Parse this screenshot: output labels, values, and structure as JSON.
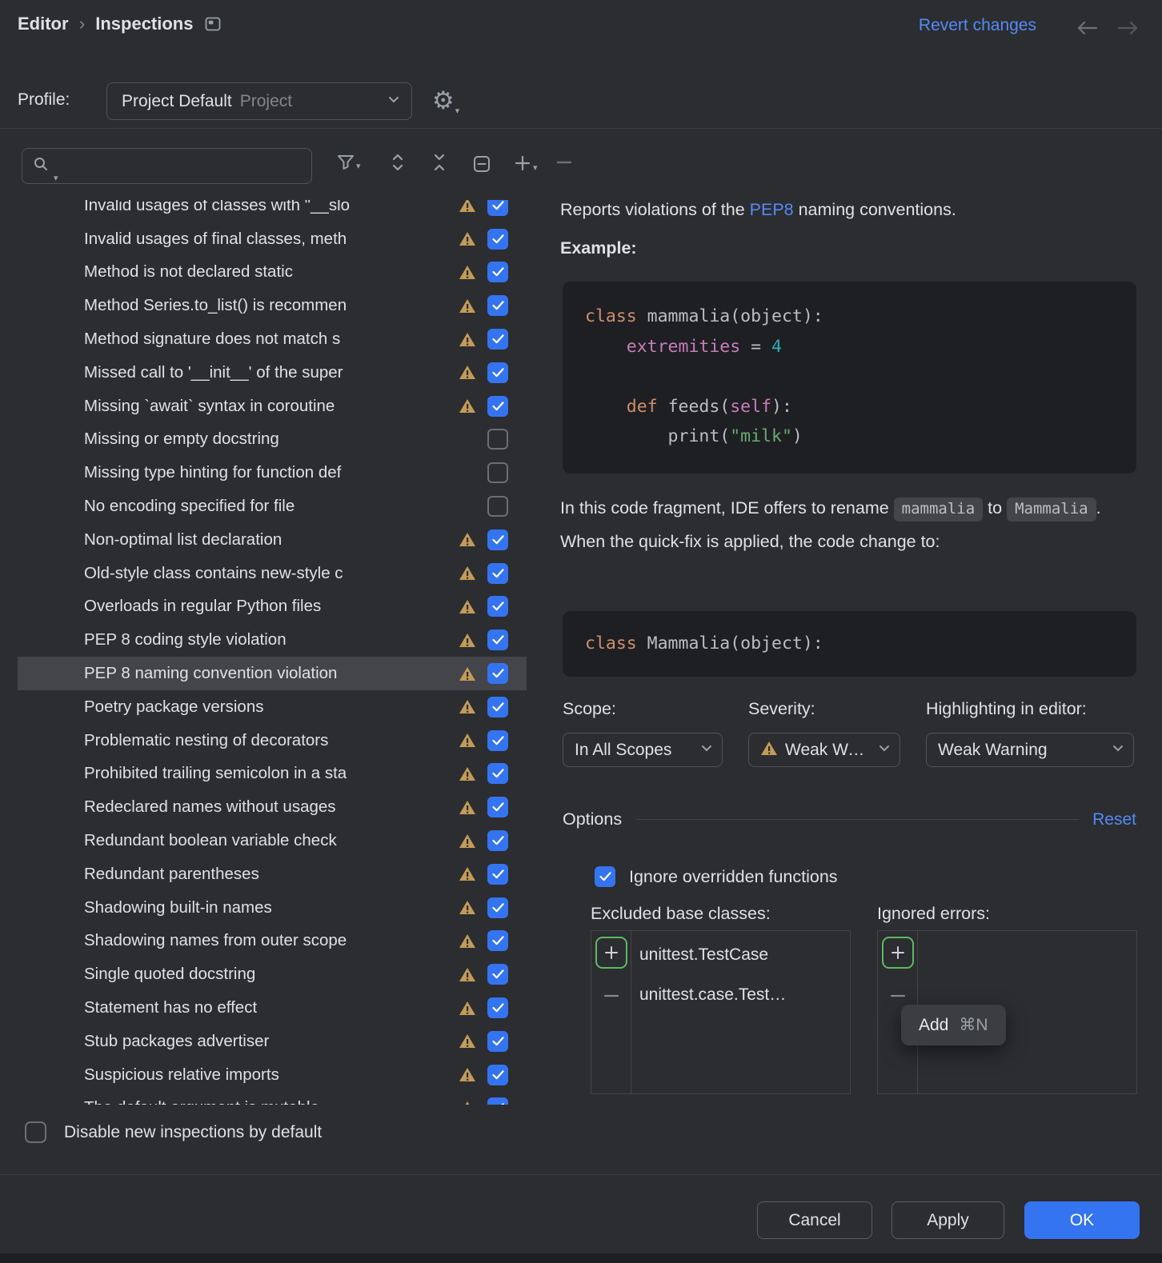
{
  "colors": {
    "accent_blue": "#3574F0",
    "link_blue": "#548AF7",
    "warning_icon": "#C39B58",
    "focus_green": "#5FB865",
    "background": "#2B2D30",
    "code_background": "#1E1F22",
    "selection_gray": "#43454A"
  },
  "header": {
    "breadcrumb": {
      "section": "Editor",
      "separator": "›",
      "page": "Inspections"
    },
    "revert_label": "Revert changes"
  },
  "profile": {
    "label": "Profile:",
    "value": "Project Default",
    "scope_hint": "Project"
  },
  "inspections": {
    "items": [
      {
        "label": "Invalid usages of classes with \"__slo",
        "warning": true,
        "checked": true,
        "selected": false
      },
      {
        "label": "Invalid usages of final classes, meth",
        "warning": true,
        "checked": true,
        "selected": false
      },
      {
        "label": "Method is not declared static",
        "warning": true,
        "checked": true,
        "selected": false
      },
      {
        "label": "Method Series.to_list() is recommen",
        "warning": true,
        "checked": true,
        "selected": false
      },
      {
        "label": "Method signature does not match s",
        "warning": true,
        "checked": true,
        "selected": false
      },
      {
        "label": "Missed call to '__init__' of the super",
        "warning": true,
        "checked": true,
        "selected": false
      },
      {
        "label": "Missing `await` syntax in coroutine",
        "warning": true,
        "checked": true,
        "selected": false
      },
      {
        "label": "Missing or empty docstring",
        "warning": false,
        "checked": false,
        "selected": false
      },
      {
        "label": "Missing type hinting for function def",
        "warning": false,
        "checked": false,
        "selected": false
      },
      {
        "label": "No encoding specified for file",
        "warning": false,
        "checked": false,
        "selected": false
      },
      {
        "label": "Non-optimal list declaration",
        "warning": true,
        "checked": true,
        "selected": false
      },
      {
        "label": "Old-style class contains new-style c",
        "warning": true,
        "checked": true,
        "selected": false
      },
      {
        "label": "Overloads in regular Python files",
        "warning": true,
        "checked": true,
        "selected": false
      },
      {
        "label": "PEP 8 coding style violation",
        "warning": true,
        "checked": true,
        "selected": false
      },
      {
        "label": "PEP 8 naming convention violation",
        "warning": true,
        "checked": true,
        "selected": true
      },
      {
        "label": "Poetry package versions",
        "warning": true,
        "checked": true,
        "selected": false
      },
      {
        "label": "Problematic nesting of decorators",
        "warning": true,
        "checked": true,
        "selected": false
      },
      {
        "label": "Prohibited trailing semicolon in a sta",
        "warning": true,
        "checked": true,
        "selected": false
      },
      {
        "label": "Redeclared names without usages",
        "warning": true,
        "checked": true,
        "selected": false
      },
      {
        "label": "Redundant boolean variable check",
        "warning": true,
        "checked": true,
        "selected": false
      },
      {
        "label": "Redundant parentheses",
        "warning": true,
        "checked": true,
        "selected": false
      },
      {
        "label": "Shadowing built-in names",
        "warning": true,
        "checked": true,
        "selected": false
      },
      {
        "label": "Shadowing names from outer scope",
        "warning": true,
        "checked": true,
        "selected": false
      },
      {
        "label": "Single quoted docstring",
        "warning": true,
        "checked": true,
        "selected": false
      },
      {
        "label": "Statement has no effect",
        "warning": true,
        "checked": true,
        "selected": false
      },
      {
        "label": "Stub packages advertiser",
        "warning": true,
        "checked": true,
        "selected": false
      },
      {
        "label": "Suspicious relative imports",
        "warning": true,
        "checked": true,
        "selected": false
      },
      {
        "label": "The default argument is mutable",
        "warning": true,
        "checked": true,
        "selected": false
      }
    ],
    "disable_new_label": "Disable new inspections by default"
  },
  "detail": {
    "description": {
      "prefix": "Reports violations of the ",
      "link": "PEP8",
      "suffix": " naming conventions."
    },
    "example_label": "Example:",
    "example_code": [
      [
        {
          "t": "class ",
          "c": "kw"
        },
        {
          "t": "mammalia(object):",
          "c": "plain"
        }
      ],
      [
        {
          "t": "    ",
          "c": "plain"
        },
        {
          "t": "extremities",
          "c": "field"
        },
        {
          "t": " = ",
          "c": "plain"
        },
        {
          "t": "4",
          "c": "num"
        }
      ],
      [],
      [
        {
          "t": "    ",
          "c": "plain"
        },
        {
          "t": "def ",
          "c": "kw"
        },
        {
          "t": "feeds(",
          "c": "plain"
        },
        {
          "t": "self",
          "c": "field"
        },
        {
          "t": "):",
          "c": "plain"
        }
      ],
      [
        {
          "t": "        print(",
          "c": "plain"
        },
        {
          "t": "\"milk\"",
          "c": "str"
        },
        {
          "t": ")",
          "c": "plain"
        }
      ]
    ],
    "rename_text": {
      "part1": "In this code fragment, IDE offers to rename ",
      "code1": "mammalia",
      "part2": " to ",
      "code2": "Mammalia",
      "part3": ". When the quick-fix is applied, the code change to:"
    },
    "result_code": [
      [
        {
          "t": "class ",
          "c": "kw"
        },
        {
          "t": "Mammalia(object):",
          "c": "plain"
        }
      ]
    ],
    "scope": {
      "label": "Scope:",
      "value": "In All Scopes"
    },
    "severity": {
      "label": "Severity:",
      "value": "Weak Warning"
    },
    "highlighting": {
      "label": "Highlighting in editor:",
      "value": "Weak Warning"
    },
    "options": {
      "title": "Options",
      "reset_label": "Reset",
      "ignore_overridden": {
        "label": "Ignore overridden functions",
        "checked": true
      },
      "excluded": {
        "label": "Excluded base classes:",
        "items": [
          "unittest.TestCase",
          "unittest.case.Test…"
        ]
      },
      "ignored": {
        "label": "Ignored errors:",
        "items": []
      },
      "tooltip": {
        "label": "Add",
        "shortcut": "⌘N"
      }
    }
  },
  "footer": {
    "cancel_label": "Cancel",
    "apply_label": "Apply",
    "ok_label": "OK"
  }
}
